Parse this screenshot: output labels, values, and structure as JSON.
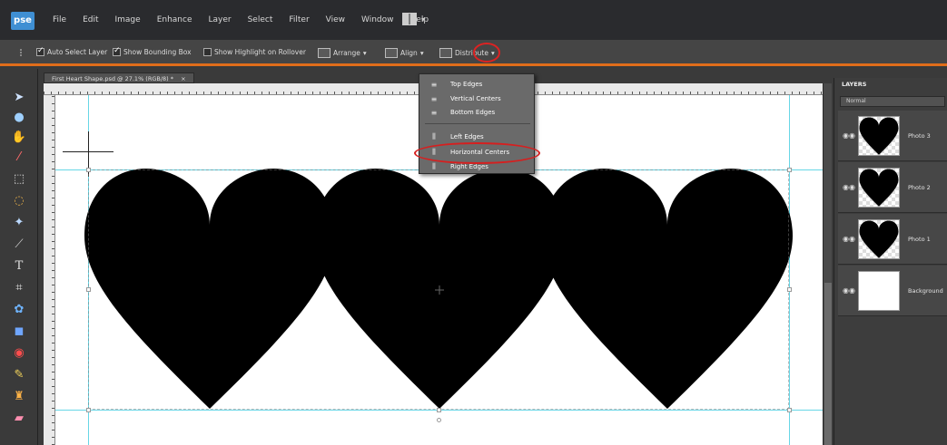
{
  "app": {
    "logo_text": "pse"
  },
  "menu": {
    "items": [
      "File",
      "Edit",
      "Image",
      "Enhance",
      "Layer",
      "Select",
      "Filter",
      "View",
      "Window",
      "Help"
    ]
  },
  "options_bar": {
    "auto_select_layer": {
      "label": "Auto Select Layer",
      "checked": true
    },
    "show_bounding_box": {
      "label": "Show Bounding Box",
      "checked": true
    },
    "show_highlight_on_rollover": {
      "label": "Show Highlight on Rollover",
      "checked": false
    },
    "arrange_label": "Arrange",
    "align_label": "Align",
    "distribute_label": "Distribute"
  },
  "document": {
    "tab_title": "First Heart Shape.psd @ 27.1% (RGB/8) *",
    "close_glyph": "×"
  },
  "distribute_menu": {
    "items": [
      {
        "label": "Top Edges",
        "icon": "top-edges-icon",
        "glyph": "≡"
      },
      {
        "label": "Vertical Centers",
        "icon": "vertical-centers-icon",
        "glyph": "≡"
      },
      {
        "label": "Bottom Edges",
        "icon": "bottom-edges-icon",
        "glyph": "≡"
      },
      {
        "label": "Left Edges",
        "icon": "left-edges-icon",
        "glyph": "⫼"
      },
      {
        "label": "Horizontal Centers",
        "icon": "horizontal-centers-icon",
        "glyph": "⫼",
        "highlighted": true
      },
      {
        "label": "Right Edges",
        "icon": "right-edges-icon",
        "glyph": "⫼"
      }
    ]
  },
  "layers_panel": {
    "title": "LAYERS",
    "blend_mode": "Normal",
    "layers": [
      {
        "name": "Photo 3",
        "type": "heart"
      },
      {
        "name": "Photo 2",
        "type": "heart"
      },
      {
        "name": "Photo 1",
        "type": "heart"
      },
      {
        "name": "Background",
        "type": "plain"
      }
    ]
  },
  "colors": {
    "accent_orange": "#e06d1a",
    "guide_cyan": "#67d6e6",
    "annotation_red": "#d61f1f",
    "heart_fill": "#000000"
  }
}
